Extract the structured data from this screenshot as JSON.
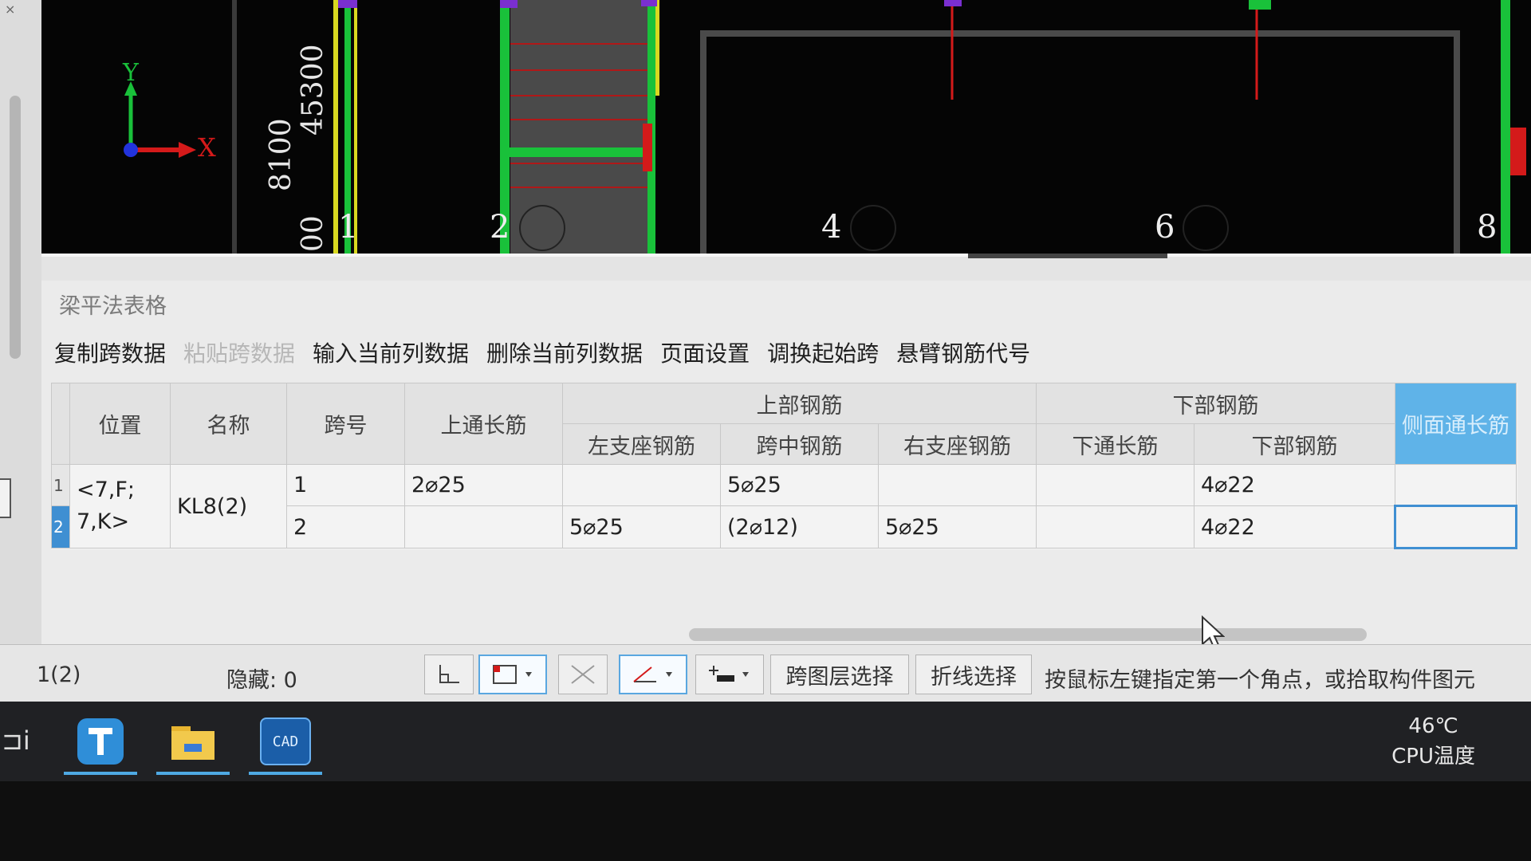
{
  "cad": {
    "axis_numbers": [
      "1",
      "2",
      "4",
      "6",
      "8"
    ],
    "dimension_texts": [
      "8100",
      "45300",
      "00"
    ],
    "ucs": {
      "y_label": "Y",
      "x_label": "X"
    },
    "colors": {
      "wall_green": "#19c13a",
      "wall_yellow": "#d8d820",
      "axis_red": "#d41a1a",
      "purple": "#7a2fd0"
    }
  },
  "panel": {
    "title": "梁平法表格",
    "toolbar": [
      {
        "label": "复制跨数据",
        "enabled": true
      },
      {
        "label": "粘贴跨数据",
        "enabled": false
      },
      {
        "label": "输入当前列数据",
        "enabled": true
      },
      {
        "label": "删除当前列数据",
        "enabled": true
      },
      {
        "label": "页面设置",
        "enabled": true
      },
      {
        "label": "调换起始跨",
        "enabled": true
      },
      {
        "label": "悬臂钢筋代号",
        "enabled": true
      }
    ],
    "table": {
      "headers": {
        "position": "位置",
        "name": "名称",
        "span": "跨号",
        "top_through": "上通长筋",
        "top_group": "上部钢筋",
        "top_left": "左支座钢筋",
        "top_mid": "跨中钢筋",
        "top_right": "右支座钢筋",
        "bottom_group": "下部钢筋",
        "bottom_through": "下通长筋",
        "bottom_bars": "下部钢筋",
        "side_through": "侧面通长筋"
      },
      "position_lines": [
        "<7,F;",
        "7,K>"
      ],
      "name": "KL8(2)",
      "rows": [
        {
          "num": "1",
          "span": "1",
          "top_through": "2⌀25",
          "top_left": "",
          "top_mid": "5⌀25",
          "top_right": "",
          "bottom_through": "",
          "bottom_bars": "4⌀22",
          "side_through": ""
        },
        {
          "num": "2",
          "span": "2",
          "top_through": "",
          "top_left": "5⌀25",
          "top_mid": "(2⌀12)",
          "top_right": "5⌀25",
          "bottom_through": "",
          "bottom_bars": "4⌀22",
          "side_through": ""
        }
      ]
    }
  },
  "statusbar": {
    "floor": "1(2)",
    "hidden": "隐藏: 0",
    "cross_layer": "跨图层选择",
    "polyline_select": "折线选择",
    "prompt": "按鼠标左键指定第一个角点，或拾取构件图元"
  },
  "taskbar": {
    "apps": [
      "T-app-icon",
      "file-explorer-icon",
      "cad-app-icon"
    ],
    "cad_label": "CAD",
    "temperature": "46℃",
    "temperature_label": "CPU温度",
    "left_glyph": "⊐i"
  }
}
